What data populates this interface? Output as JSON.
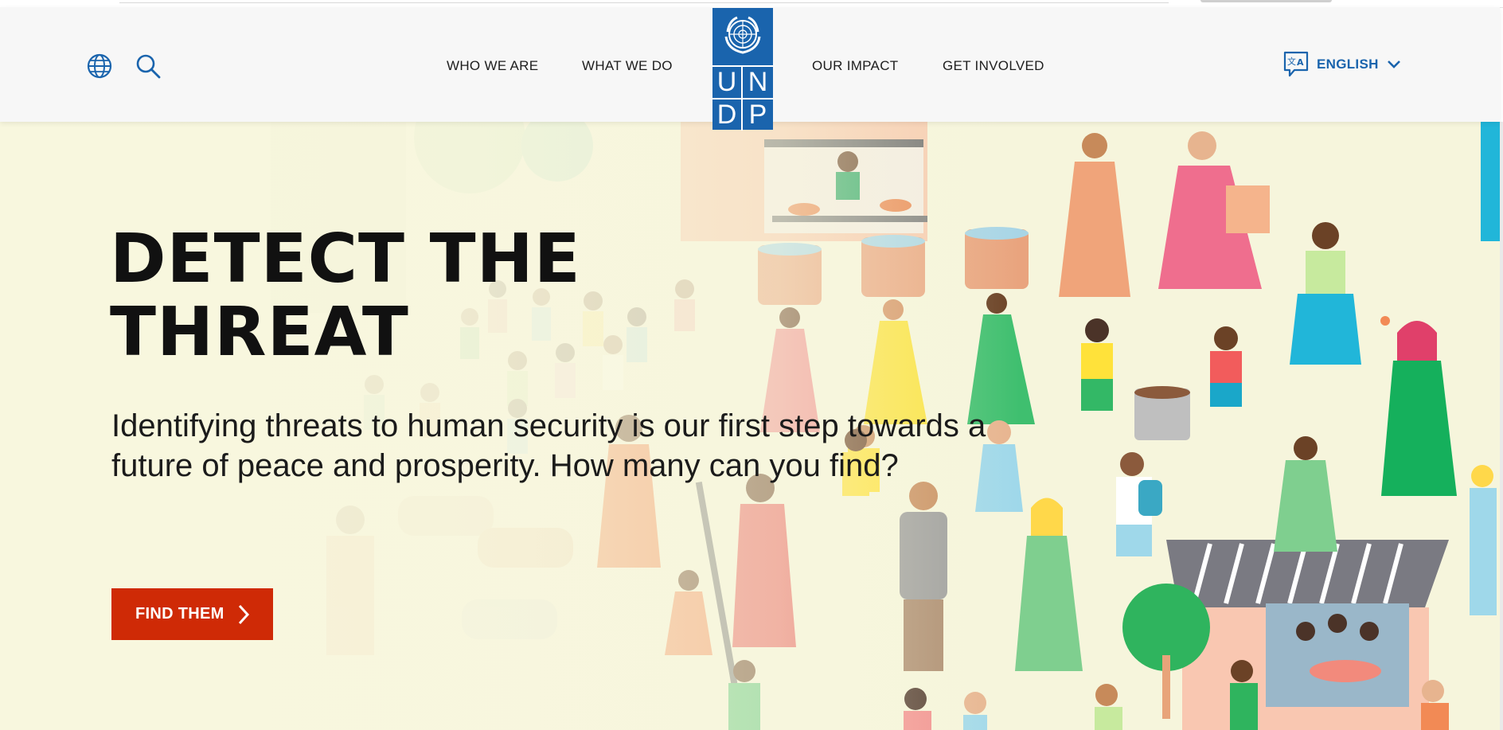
{
  "header": {
    "nav_left": [
      {
        "label": "WHO WE ARE"
      },
      {
        "label": "WHAT WE DO"
      }
    ],
    "nav_right": [
      {
        "label": "OUR IMPACT"
      },
      {
        "label": "GET INVOLVED"
      }
    ],
    "logo": {
      "letters": [
        "U",
        "N",
        "D",
        "P"
      ],
      "icon": "un-emblem-icon"
    },
    "globe_icon": "globe-icon",
    "search_icon": "search-icon",
    "language": {
      "label": "ENGLISH",
      "icon": "translate-icon",
      "chevron": "chevron-down-icon"
    }
  },
  "hero": {
    "title_line1": "DETECT THE",
    "title_line2": "THREAT",
    "description": "Identifying threats to human security is our first step towards a future of peace and prosperity. How many can you find?",
    "cta_label": "FIND THEM",
    "cta_icon": "chevron-right-icon"
  },
  "colors": {
    "brand_blue": "#1a64ad",
    "cta_red": "#cf2a06",
    "hero_background": "#f6f5dc",
    "header_background": "#f7f7f7"
  }
}
